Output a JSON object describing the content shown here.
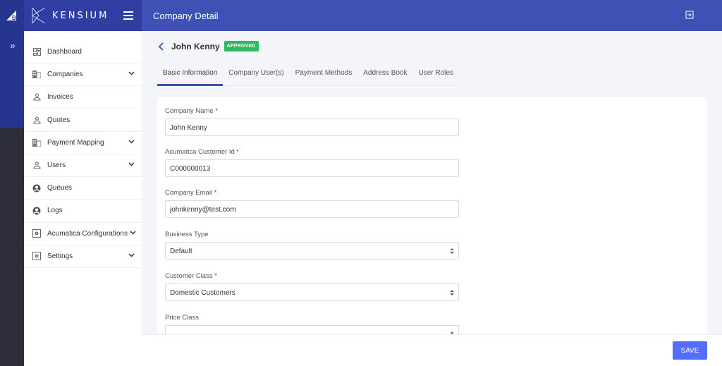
{
  "brand": {
    "name": "KENSIUM"
  },
  "header": {
    "title": "Company Detail"
  },
  "sidebar": {
    "items": [
      {
        "label": "Dashboard",
        "icon": "dashboard-icon",
        "expandable": false
      },
      {
        "label": "Companies",
        "icon": "building-icon",
        "expandable": true
      },
      {
        "label": "Invoices",
        "icon": "person-icon",
        "expandable": false
      },
      {
        "label": "Quotes",
        "icon": "person-icon",
        "expandable": false
      },
      {
        "label": "Payment Mapping",
        "icon": "building-icon",
        "expandable": true
      },
      {
        "label": "Users",
        "icon": "person-icon",
        "expandable": true
      },
      {
        "label": "Queues",
        "icon": "account-circle-icon",
        "expandable": false
      },
      {
        "label": "Logs",
        "icon": "account-circle-icon",
        "expandable": false
      },
      {
        "label": "Acumatica Configurations",
        "icon": "settings-box-icon",
        "expandable": true
      },
      {
        "label": "Settings",
        "icon": "settings-box-icon",
        "expandable": true
      }
    ]
  },
  "page": {
    "title": "John Kenny",
    "status": "APPROVED",
    "status_color": "#2fb85e",
    "tabs": [
      {
        "label": "Basic Information",
        "active": true
      },
      {
        "label": "Company User(s)",
        "active": false
      },
      {
        "label": "Payment Methods",
        "active": false
      },
      {
        "label": "Address Book",
        "active": false
      },
      {
        "label": "User Roles",
        "active": false
      }
    ]
  },
  "form": {
    "company_name": {
      "label": "Company Name *",
      "value": "John Kenny"
    },
    "customer_id": {
      "label": "Acumatica Customer Id *",
      "value": "C000000013"
    },
    "email": {
      "label": "Company Email *",
      "value": "johnkenny@test.com"
    },
    "business_type": {
      "label": "Business Type",
      "value": "Default"
    },
    "customer_class": {
      "label": "Customer Class *",
      "value": "Domestic Customers"
    },
    "price_class": {
      "label": "Price Class",
      "value": ""
    }
  },
  "footer": {
    "save_label": "SAVE"
  },
  "colors": {
    "accent": "#3f51b5",
    "primary_button": "#536dfe"
  }
}
